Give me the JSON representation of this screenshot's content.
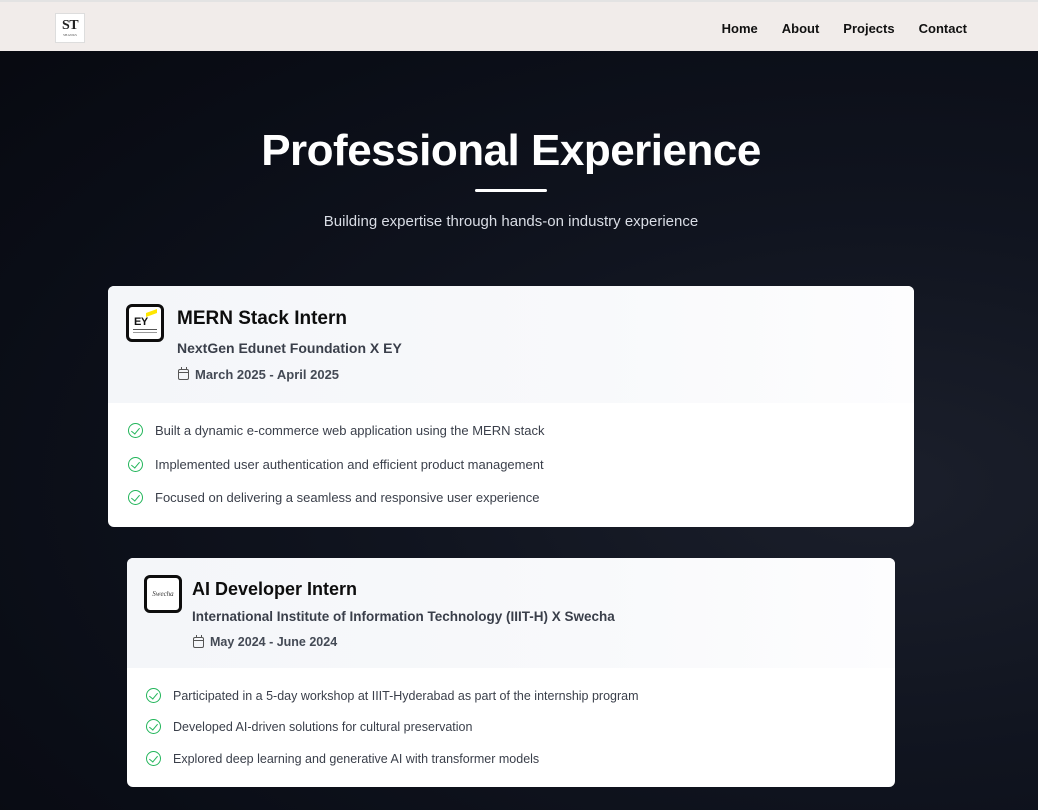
{
  "header": {
    "logo_text": "ST",
    "logo_subtext": "SHANKS",
    "nav": [
      {
        "label": "Home"
      },
      {
        "label": "About"
      },
      {
        "label": "Projects"
      },
      {
        "label": "Contact"
      }
    ]
  },
  "hero": {
    "title": "Professional Experience",
    "subtitle": "Building expertise through hands-on industry experience"
  },
  "experiences": [
    {
      "logo": "EY",
      "title": "MERN Stack Intern",
      "organization": "NextGen Edunet Foundation X EY",
      "dates": "March 2025 - April 2025",
      "points": [
        "Built a dynamic e-commerce web application using the MERN stack",
        "Implemented user authentication and efficient product management",
        "Focused on delivering a seamless and responsive user experience"
      ]
    },
    {
      "logo": "Swecha",
      "title": "AI Developer Intern",
      "organization": "International Institute of Information Technology (IIIT-H) X Swecha",
      "dates": "May 2024 - June 2024",
      "points": [
        "Participated in a 5-day workshop at IIIT-Hyderabad as part of the internship program",
        "Developed AI-driven solutions for cultural preservation",
        "Explored deep learning and generative AI with transformer models"
      ]
    }
  ],
  "colors": {
    "nav_bg": "#f1ecea",
    "page_bg": "#0a0d16",
    "check": "#22b55a"
  }
}
